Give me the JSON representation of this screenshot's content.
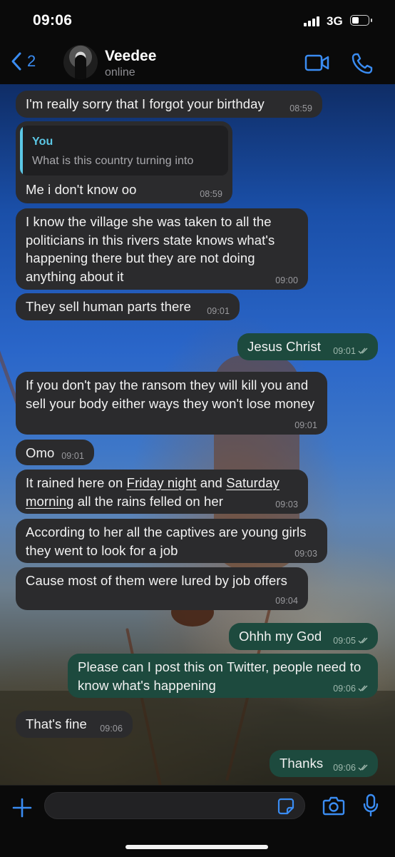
{
  "status_bar": {
    "time": "09:06",
    "network": "3G"
  },
  "header": {
    "back_count": "2",
    "contact_name": "Veedee",
    "contact_status": "online"
  },
  "colors": {
    "accent": "#3a8cf2",
    "incoming_bubble": "#2b2b2d",
    "outgoing_bubble": "#1d4a3e",
    "quote_accent": "#5bc7e5"
  },
  "messages": [
    {
      "text": "I'm really sorry that I forgot your birthday",
      "time": "08:59"
    },
    {
      "quote_author": "You",
      "quote_text": "What is this country turning into",
      "text": "Me i don't know oo",
      "time": "08:59"
    },
    {
      "text": "I know the village she was taken to all the politicians in this rivers state knows what's happening there but they are not doing anything about it",
      "time": "09:00"
    },
    {
      "text": "They sell human parts there",
      "time": "09:01"
    },
    {
      "text": "Jesus Christ",
      "time": "09:01"
    },
    {
      "text": "If you don't pay the ransom they will kill you and sell your body either ways they won't lose money",
      "time": "09:01"
    },
    {
      "text": "Omo",
      "time": "09:01"
    },
    {
      "text_parts": [
        "It rained here on ",
        "Friday night",
        " and ",
        "Saturday morning",
        " all the rains felled on her"
      ],
      "time": "09:03"
    },
    {
      "text": "According to her all the captives are young girls they went to look for a job",
      "time": "09:03"
    },
    {
      "text": "Cause most of them were lured by job offers",
      "time": "09:04"
    },
    {
      "text": "Ohhh my God",
      "time": "09:05"
    },
    {
      "text": "Please can I post this on Twitter, people need to know what's happening",
      "time": "09:06"
    },
    {
      "text": "That's fine",
      "time": "09:06"
    },
    {
      "text": "Thanks",
      "time": "09:06"
    }
  ],
  "icons": {
    "back": "chevron-left-icon",
    "video": "video-camera-icon",
    "call": "phone-icon",
    "plus": "plus-icon",
    "sticker": "sticker-icon",
    "camera": "camera-icon",
    "mic": "microphone-icon"
  }
}
